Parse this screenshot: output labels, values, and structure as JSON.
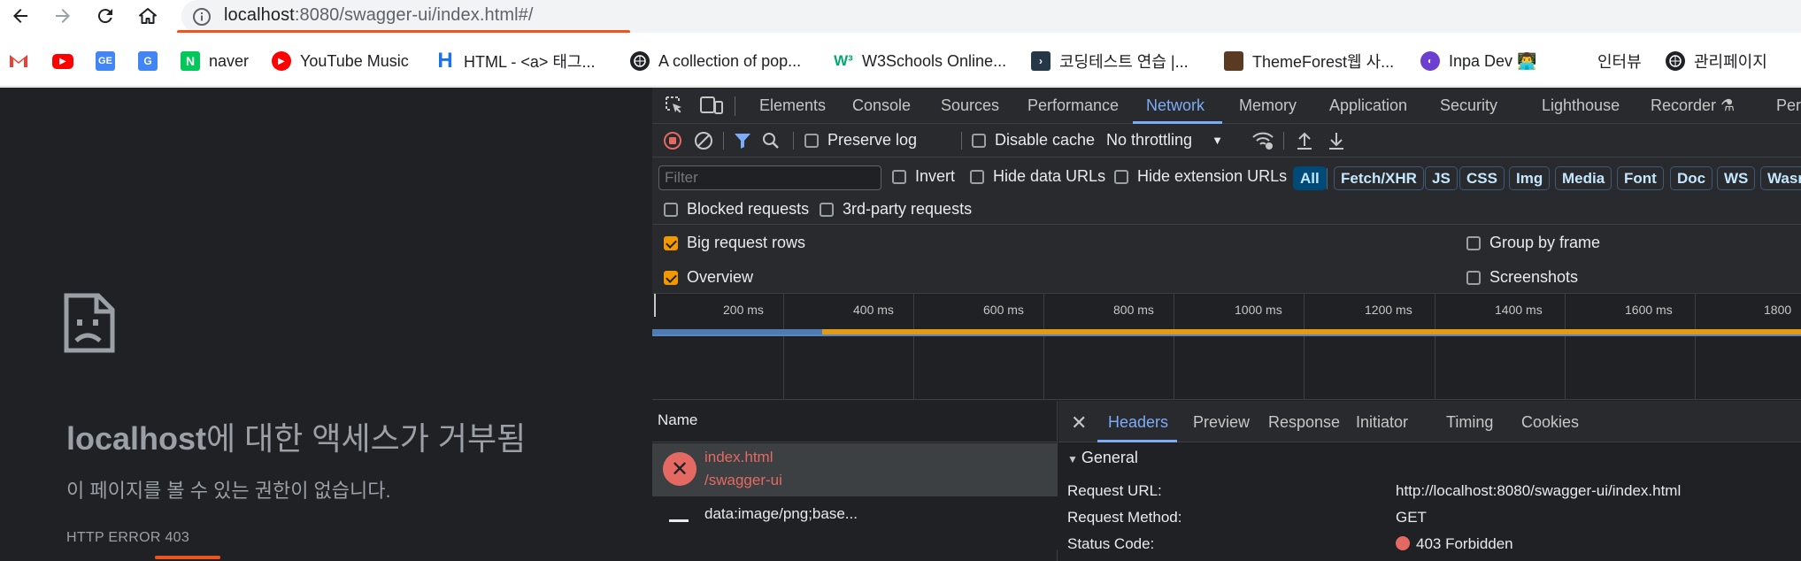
{
  "browser": {
    "url_host": "localhost",
    "url_rest": ":8080/swagger-ui/index.html#/",
    "nav": {
      "back": "back-arrow",
      "forward": "forward-arrow",
      "reload": "reload",
      "home": "home"
    }
  },
  "bookmarks": [
    {
      "label": "",
      "icon": "gmail-icon",
      "color": "#ea4335"
    },
    {
      "label": "",
      "icon": "youtube-icon",
      "color": "#ff0000"
    },
    {
      "label": "",
      "icon": "google-sheets-icon",
      "color": "#4285f4"
    },
    {
      "label": "",
      "icon": "google-translate-icon",
      "color": "#4285f4"
    },
    {
      "label": "naver",
      "icon": "naver-icon",
      "color": "#03c75a"
    },
    {
      "label": "YouTube Music",
      "icon": "youtube-music-icon",
      "color": "#ff0000"
    },
    {
      "label": "HTML - <a> 태그...",
      "icon": "h-icon",
      "color": "#1a73e8"
    },
    {
      "label": "A collection of pop...",
      "icon": "globe-icon",
      "color": "#202124"
    },
    {
      "label": "W3Schools Online...",
      "icon": "w3schools-icon",
      "color": "#04aa6d"
    },
    {
      "label": "코딩테스트 연습 |...",
      "icon": "programmers-icon",
      "color": "#263747"
    },
    {
      "label": "ThemeForest웹 사...",
      "icon": "themeforest-icon",
      "color": "#82b440"
    },
    {
      "label": "Inpa Dev 👨‍💻",
      "icon": "inpa-icon",
      "color": "#6c3fd1"
    },
    {
      "label": "인터뷰",
      "icon": "",
      "color": ""
    },
    {
      "label": "관리페이지",
      "icon": "globe-icon",
      "color": "#202124"
    }
  ],
  "error_page": {
    "title_host": "localhost",
    "title_rest": "에 대한 액세스가 거부됨",
    "subtitle": "이 페이지를 볼 수 있는 권한이 없습니다.",
    "code": "HTTP ERROR 403"
  },
  "devtools": {
    "tabs": [
      "Elements",
      "Console",
      "Sources",
      "Performance",
      "Network",
      "Memory",
      "Application",
      "Security",
      "Lighthouse",
      "Recorder",
      "Per"
    ],
    "active_tab": "Network",
    "toolbar": {
      "preserve_log": "Preserve log",
      "disable_cache": "Disable cache",
      "throttling": "No throttling"
    },
    "filter": {
      "placeholder": "Filter",
      "invert": "Invert",
      "hide_data_urls": "Hide data URLs",
      "hide_extension_urls": "Hide extension URLs",
      "types": [
        "All",
        "Fetch/XHR",
        "JS",
        "CSS",
        "Img",
        "Media",
        "Font",
        "Doc",
        "WS",
        "Wasm"
      ],
      "active_type": "All"
    },
    "row3": {
      "blocked": "Blocked requests",
      "third_party": "3rd-party requests"
    },
    "settings": {
      "big_rows": "Big request rows",
      "overview": "Overview",
      "group_by_frame": "Group by frame",
      "screenshots": "Screenshots",
      "big_rows_checked": true,
      "overview_checked": true
    },
    "timeline_ticks": [
      "200 ms",
      "400 ms",
      "600 ms",
      "800 ms",
      "1000 ms",
      "1200 ms",
      "1400 ms",
      "1600 ms",
      "1800"
    ],
    "request_list": {
      "header": "Name",
      "rows": [
        {
          "name": "index.html",
          "path": "/swagger-ui",
          "status": "error"
        },
        {
          "name": "data:image/png;base...",
          "path": "",
          "status": "ok"
        }
      ]
    },
    "details": {
      "tabs": [
        "Headers",
        "Preview",
        "Response",
        "Initiator",
        "Timing",
        "Cookies"
      ],
      "active_tab": "Headers",
      "section": "General",
      "fields": [
        {
          "key": "Request URL:",
          "value": "http://localhost:8080/swagger-ui/index.html"
        },
        {
          "key": "Request Method:",
          "value": "GET"
        },
        {
          "key": "Status Code:",
          "value": "403 Forbidden"
        }
      ]
    }
  }
}
